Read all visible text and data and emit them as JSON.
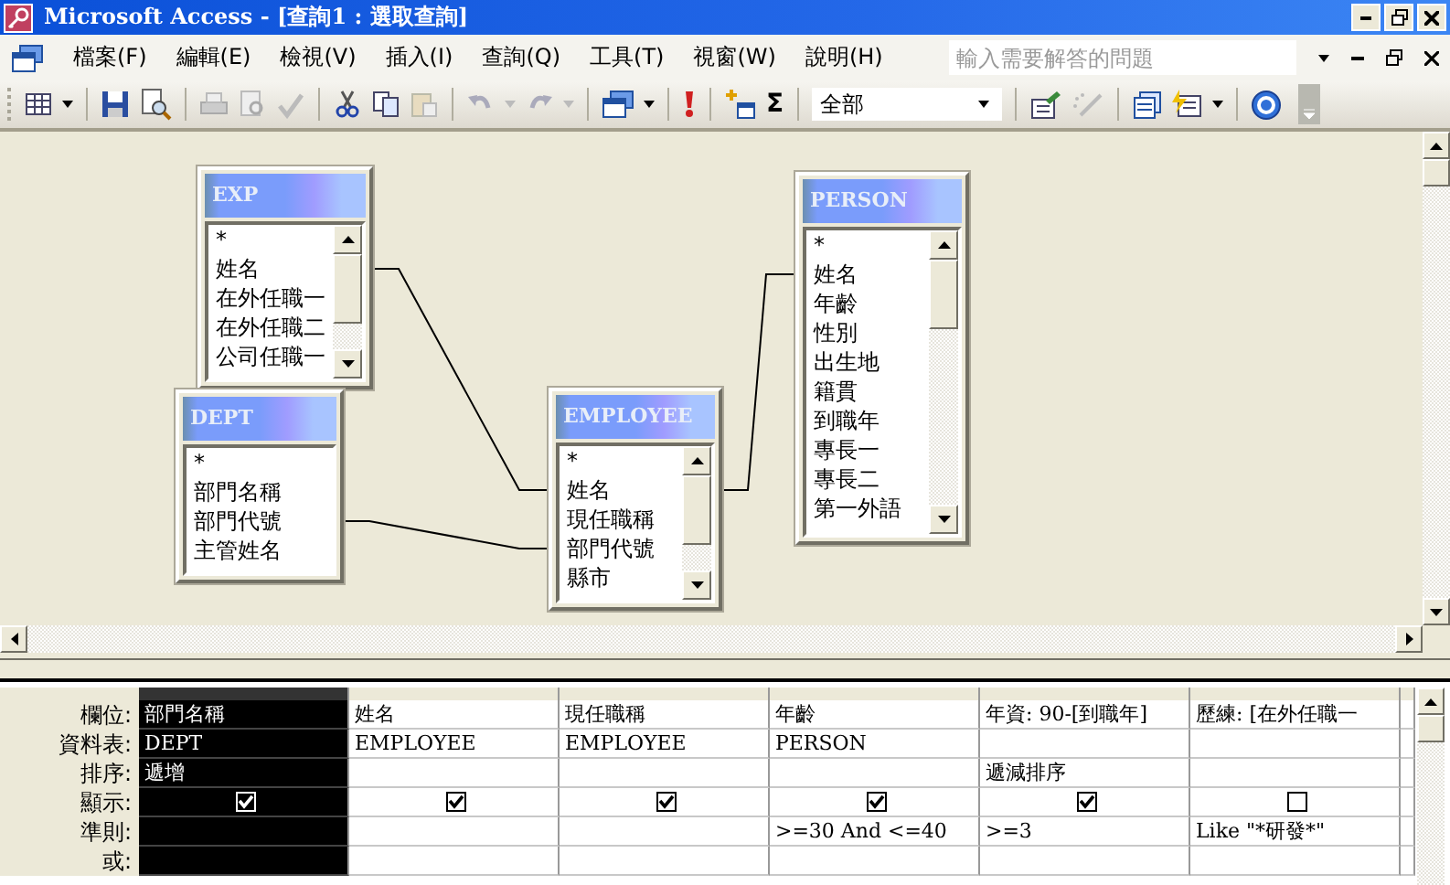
{
  "window": {
    "title": "Microsoft Access - [查詢1 : 選取查詢]"
  },
  "menu_bar": {
    "items": [
      "檔案(F)",
      "編輯(E)",
      "檢視(V)",
      "插入(I)",
      "查詢(Q)",
      "工具(T)",
      "視窗(W)",
      "說明(H)"
    ],
    "help_box": {
      "placeholder": "輸入需要解答的問題"
    }
  },
  "toolbar": {
    "totals_symbol": "Σ",
    "top_values": {
      "value": "全部"
    }
  },
  "tables": [
    {
      "name": "EXP",
      "fields": [
        "*",
        "姓名",
        "在外任職一",
        "在外任職二",
        "公司任職一"
      ]
    },
    {
      "name": "DEPT",
      "fields": [
        "*",
        "部門名稱",
        "部門代號",
        "主管姓名"
      ]
    },
    {
      "name": "EMPLOYEE",
      "fields": [
        "*",
        "姓名",
        "現任職稱",
        "部門代號",
        "縣市"
      ]
    },
    {
      "name": "PERSON",
      "fields": [
        "*",
        "姓名",
        "年齡",
        "性別",
        "出生地",
        "籍貫",
        "到職年",
        "專長一",
        "專長二",
        "第一外語"
      ]
    }
  ],
  "grid": {
    "row_labels": [
      "欄位:",
      "資料表:",
      "排序:",
      "顯示:",
      "準則:",
      "或:"
    ],
    "columns": [
      {
        "selected": true,
        "field": "部門名稱",
        "table": "DEPT",
        "sort": "遞增",
        "show": true
      },
      {
        "selected": false,
        "field": "姓名",
        "table": "EMPLOYEE",
        "show": true
      },
      {
        "selected": false,
        "field": "現任職稱",
        "table": "EMPLOYEE",
        "show": true
      },
      {
        "selected": false,
        "field": "年齡",
        "table": "PERSON",
        "show": true,
        "criteria": ">=30 And <=40"
      },
      {
        "selected": false,
        "field": "年資: 90-[到職年]",
        "sort": "遞減排序",
        "show": true,
        "criteria": ">=3"
      },
      {
        "selected": false,
        "field": "歷練: [在外任職一",
        "show": false,
        "criteria": "Like \"*研發*\""
      }
    ]
  }
}
